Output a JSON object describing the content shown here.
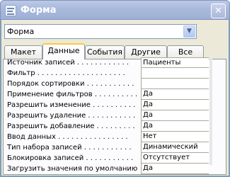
{
  "window": {
    "title": "Форма",
    "close_glyph": "✕"
  },
  "object_selector": {
    "value": "Форма",
    "arrow_glyph": "▼"
  },
  "tabs": [
    {
      "label": "Макет",
      "active": false
    },
    {
      "label": "Данные",
      "active": true
    },
    {
      "label": "События",
      "active": false
    },
    {
      "label": "Другие",
      "active": false
    },
    {
      "label": "Все",
      "active": false
    }
  ],
  "properties": [
    {
      "label": "Источник записей . . . . . . . . . . . .",
      "value": "Пациенты"
    },
    {
      "label": "Фильтр . . . . . . . . . . . . . . . . . . . .",
      "value": ""
    },
    {
      "label": "Порядок сортировки . . . . . . . . . . .",
      "value": ""
    },
    {
      "label": "Применение фильтров . . . . . . . . . .",
      "value": "Да"
    },
    {
      "label": "Разрешить изменение . . . . . . . . . .",
      "value": "Да"
    },
    {
      "label": "Разрешить удаление . . . . . . . . . . .",
      "value": "Да"
    },
    {
      "label": "Разрешить добавление . . . . . . . . .",
      "value": "Да"
    },
    {
      "label": "Ввод данных . . . . . . . . . . . . . . . .",
      "value": "Нет"
    },
    {
      "label": "Тип набора записей . . . . . . . . . . .",
      "value": "Динамический"
    },
    {
      "label": "Блокировка записей . . . . . . . . . . .",
      "value": "Отсутствует"
    },
    {
      "label": "Загрузить значения по умолчанию . .",
      "value": "Да"
    }
  ]
}
